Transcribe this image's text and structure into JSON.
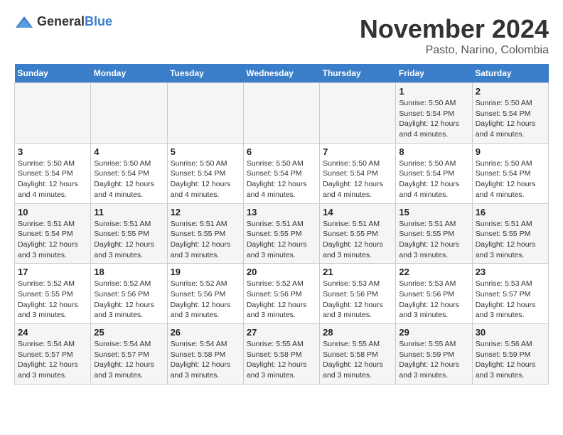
{
  "header": {
    "logo_general": "General",
    "logo_blue": "Blue",
    "month": "November 2024",
    "location": "Pasto, Narino, Colombia"
  },
  "weekdays": [
    "Sunday",
    "Monday",
    "Tuesday",
    "Wednesday",
    "Thursday",
    "Friday",
    "Saturday"
  ],
  "weeks": [
    [
      {
        "day": "",
        "info": ""
      },
      {
        "day": "",
        "info": ""
      },
      {
        "day": "",
        "info": ""
      },
      {
        "day": "",
        "info": ""
      },
      {
        "day": "",
        "info": ""
      },
      {
        "day": "1",
        "info": "Sunrise: 5:50 AM\nSunset: 5:54 PM\nDaylight: 12 hours and 4 minutes."
      },
      {
        "day": "2",
        "info": "Sunrise: 5:50 AM\nSunset: 5:54 PM\nDaylight: 12 hours and 4 minutes."
      }
    ],
    [
      {
        "day": "3",
        "info": "Sunrise: 5:50 AM\nSunset: 5:54 PM\nDaylight: 12 hours and 4 minutes."
      },
      {
        "day": "4",
        "info": "Sunrise: 5:50 AM\nSunset: 5:54 PM\nDaylight: 12 hours and 4 minutes."
      },
      {
        "day": "5",
        "info": "Sunrise: 5:50 AM\nSunset: 5:54 PM\nDaylight: 12 hours and 4 minutes."
      },
      {
        "day": "6",
        "info": "Sunrise: 5:50 AM\nSunset: 5:54 PM\nDaylight: 12 hours and 4 minutes."
      },
      {
        "day": "7",
        "info": "Sunrise: 5:50 AM\nSunset: 5:54 PM\nDaylight: 12 hours and 4 minutes."
      },
      {
        "day": "8",
        "info": "Sunrise: 5:50 AM\nSunset: 5:54 PM\nDaylight: 12 hours and 4 minutes."
      },
      {
        "day": "9",
        "info": "Sunrise: 5:50 AM\nSunset: 5:54 PM\nDaylight: 12 hours and 4 minutes."
      }
    ],
    [
      {
        "day": "10",
        "info": "Sunrise: 5:51 AM\nSunset: 5:54 PM\nDaylight: 12 hours and 3 minutes."
      },
      {
        "day": "11",
        "info": "Sunrise: 5:51 AM\nSunset: 5:55 PM\nDaylight: 12 hours and 3 minutes."
      },
      {
        "day": "12",
        "info": "Sunrise: 5:51 AM\nSunset: 5:55 PM\nDaylight: 12 hours and 3 minutes."
      },
      {
        "day": "13",
        "info": "Sunrise: 5:51 AM\nSunset: 5:55 PM\nDaylight: 12 hours and 3 minutes."
      },
      {
        "day": "14",
        "info": "Sunrise: 5:51 AM\nSunset: 5:55 PM\nDaylight: 12 hours and 3 minutes."
      },
      {
        "day": "15",
        "info": "Sunrise: 5:51 AM\nSunset: 5:55 PM\nDaylight: 12 hours and 3 minutes."
      },
      {
        "day": "16",
        "info": "Sunrise: 5:51 AM\nSunset: 5:55 PM\nDaylight: 12 hours and 3 minutes."
      }
    ],
    [
      {
        "day": "17",
        "info": "Sunrise: 5:52 AM\nSunset: 5:55 PM\nDaylight: 12 hours and 3 minutes."
      },
      {
        "day": "18",
        "info": "Sunrise: 5:52 AM\nSunset: 5:56 PM\nDaylight: 12 hours and 3 minutes."
      },
      {
        "day": "19",
        "info": "Sunrise: 5:52 AM\nSunset: 5:56 PM\nDaylight: 12 hours and 3 minutes."
      },
      {
        "day": "20",
        "info": "Sunrise: 5:52 AM\nSunset: 5:56 PM\nDaylight: 12 hours and 3 minutes."
      },
      {
        "day": "21",
        "info": "Sunrise: 5:53 AM\nSunset: 5:56 PM\nDaylight: 12 hours and 3 minutes."
      },
      {
        "day": "22",
        "info": "Sunrise: 5:53 AM\nSunset: 5:56 PM\nDaylight: 12 hours and 3 minutes."
      },
      {
        "day": "23",
        "info": "Sunrise: 5:53 AM\nSunset: 5:57 PM\nDaylight: 12 hours and 3 minutes."
      }
    ],
    [
      {
        "day": "24",
        "info": "Sunrise: 5:54 AM\nSunset: 5:57 PM\nDaylight: 12 hours and 3 minutes."
      },
      {
        "day": "25",
        "info": "Sunrise: 5:54 AM\nSunset: 5:57 PM\nDaylight: 12 hours and 3 minutes."
      },
      {
        "day": "26",
        "info": "Sunrise: 5:54 AM\nSunset: 5:58 PM\nDaylight: 12 hours and 3 minutes."
      },
      {
        "day": "27",
        "info": "Sunrise: 5:55 AM\nSunset: 5:58 PM\nDaylight: 12 hours and 3 minutes."
      },
      {
        "day": "28",
        "info": "Sunrise: 5:55 AM\nSunset: 5:58 PM\nDaylight: 12 hours and 3 minutes."
      },
      {
        "day": "29",
        "info": "Sunrise: 5:55 AM\nSunset: 5:59 PM\nDaylight: 12 hours and 3 minutes."
      },
      {
        "day": "30",
        "info": "Sunrise: 5:56 AM\nSunset: 5:59 PM\nDaylight: 12 hours and 3 minutes."
      }
    ]
  ]
}
